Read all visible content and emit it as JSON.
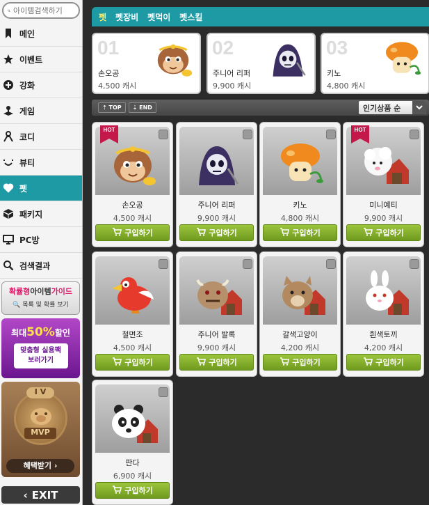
{
  "sidebar": {
    "search_placeholder": "아이템검색하기",
    "items": [
      {
        "label": "메인",
        "icon": "bookmark-icon"
      },
      {
        "label": "이벤트",
        "icon": "star-icon"
      },
      {
        "label": "강화",
        "icon": "plus-circle-icon"
      },
      {
        "label": "게임",
        "icon": "joystick-icon"
      },
      {
        "label": "코디",
        "icon": "person-icon"
      },
      {
        "label": "뷰티",
        "icon": "smile-icon"
      },
      {
        "label": "펫",
        "icon": "heart-icon",
        "active": true
      },
      {
        "label": "패키지",
        "icon": "box-icon"
      },
      {
        "label": "PC방",
        "icon": "monitor-icon"
      },
      {
        "label": "검색결과",
        "icon": "search-icon"
      }
    ],
    "promo_guide": {
      "line1_a": "확률형",
      "line1_b": "아이템",
      "line1_c": "가이드",
      "line2": "목록 및 확률 보기"
    },
    "promo_sale": {
      "prefix": "최대",
      "percent": "50%",
      "suffix": "할인",
      "btn_line1": "맞춤형 실용팩",
      "btn_line2": "보러가기"
    },
    "promo_mvp": {
      "rank": "I V",
      "badge": "MVP",
      "benefit": "혜택받기"
    },
    "exit_label": "EXIT"
  },
  "tabs": [
    {
      "label": "펫",
      "active": true
    },
    {
      "label": "펫장비"
    },
    {
      "label": "펫먹이"
    },
    {
      "label": "펫스킬"
    }
  ],
  "top3": [
    {
      "rank": "01",
      "name": "손오공",
      "price": "4,500 캐시"
    },
    {
      "rank": "02",
      "name": "주니어 리퍼",
      "price": "9,900 캐시"
    },
    {
      "rank": "03",
      "name": "키노",
      "price": "4,800 캐시"
    }
  ],
  "toolbar": {
    "top_label": "TOP",
    "end_label": "END",
    "sort_label": "인기상품 순"
  },
  "buy_label": "구입하기",
  "items": [
    {
      "name": "손오공",
      "price": "4,500 캐시",
      "hot": true,
      "pet": "monkey"
    },
    {
      "name": "주니어 리퍼",
      "price": "9,900 캐시",
      "hot": false,
      "pet": "reaper"
    },
    {
      "name": "키노",
      "price": "4,800 캐시",
      "hot": false,
      "pet": "mushroom"
    },
    {
      "name": "미니예티",
      "price": "9,900 캐시",
      "hot": true,
      "pet": "yeti"
    },
    {
      "name": "철면조",
      "price": "4,500 캐시",
      "hot": false,
      "pet": "bird"
    },
    {
      "name": "주니어 발록",
      "price": "9,900 캐시",
      "hot": false,
      "pet": "balrog"
    },
    {
      "name": "갈색고양이",
      "price": "4,200 캐시",
      "hot": false,
      "pet": "cat"
    },
    {
      "name": "흰색토끼",
      "price": "4,200 캐시",
      "hot": false,
      "pet": "rabbit"
    },
    {
      "name": "판다",
      "price": "6,900 캐시",
      "hot": false,
      "pet": "panda"
    }
  ],
  "hot_label": "HOT",
  "colors": {
    "accent": "#1e9aa5",
    "buy_green": "#7fab28",
    "hot_red": "#c4184a"
  }
}
